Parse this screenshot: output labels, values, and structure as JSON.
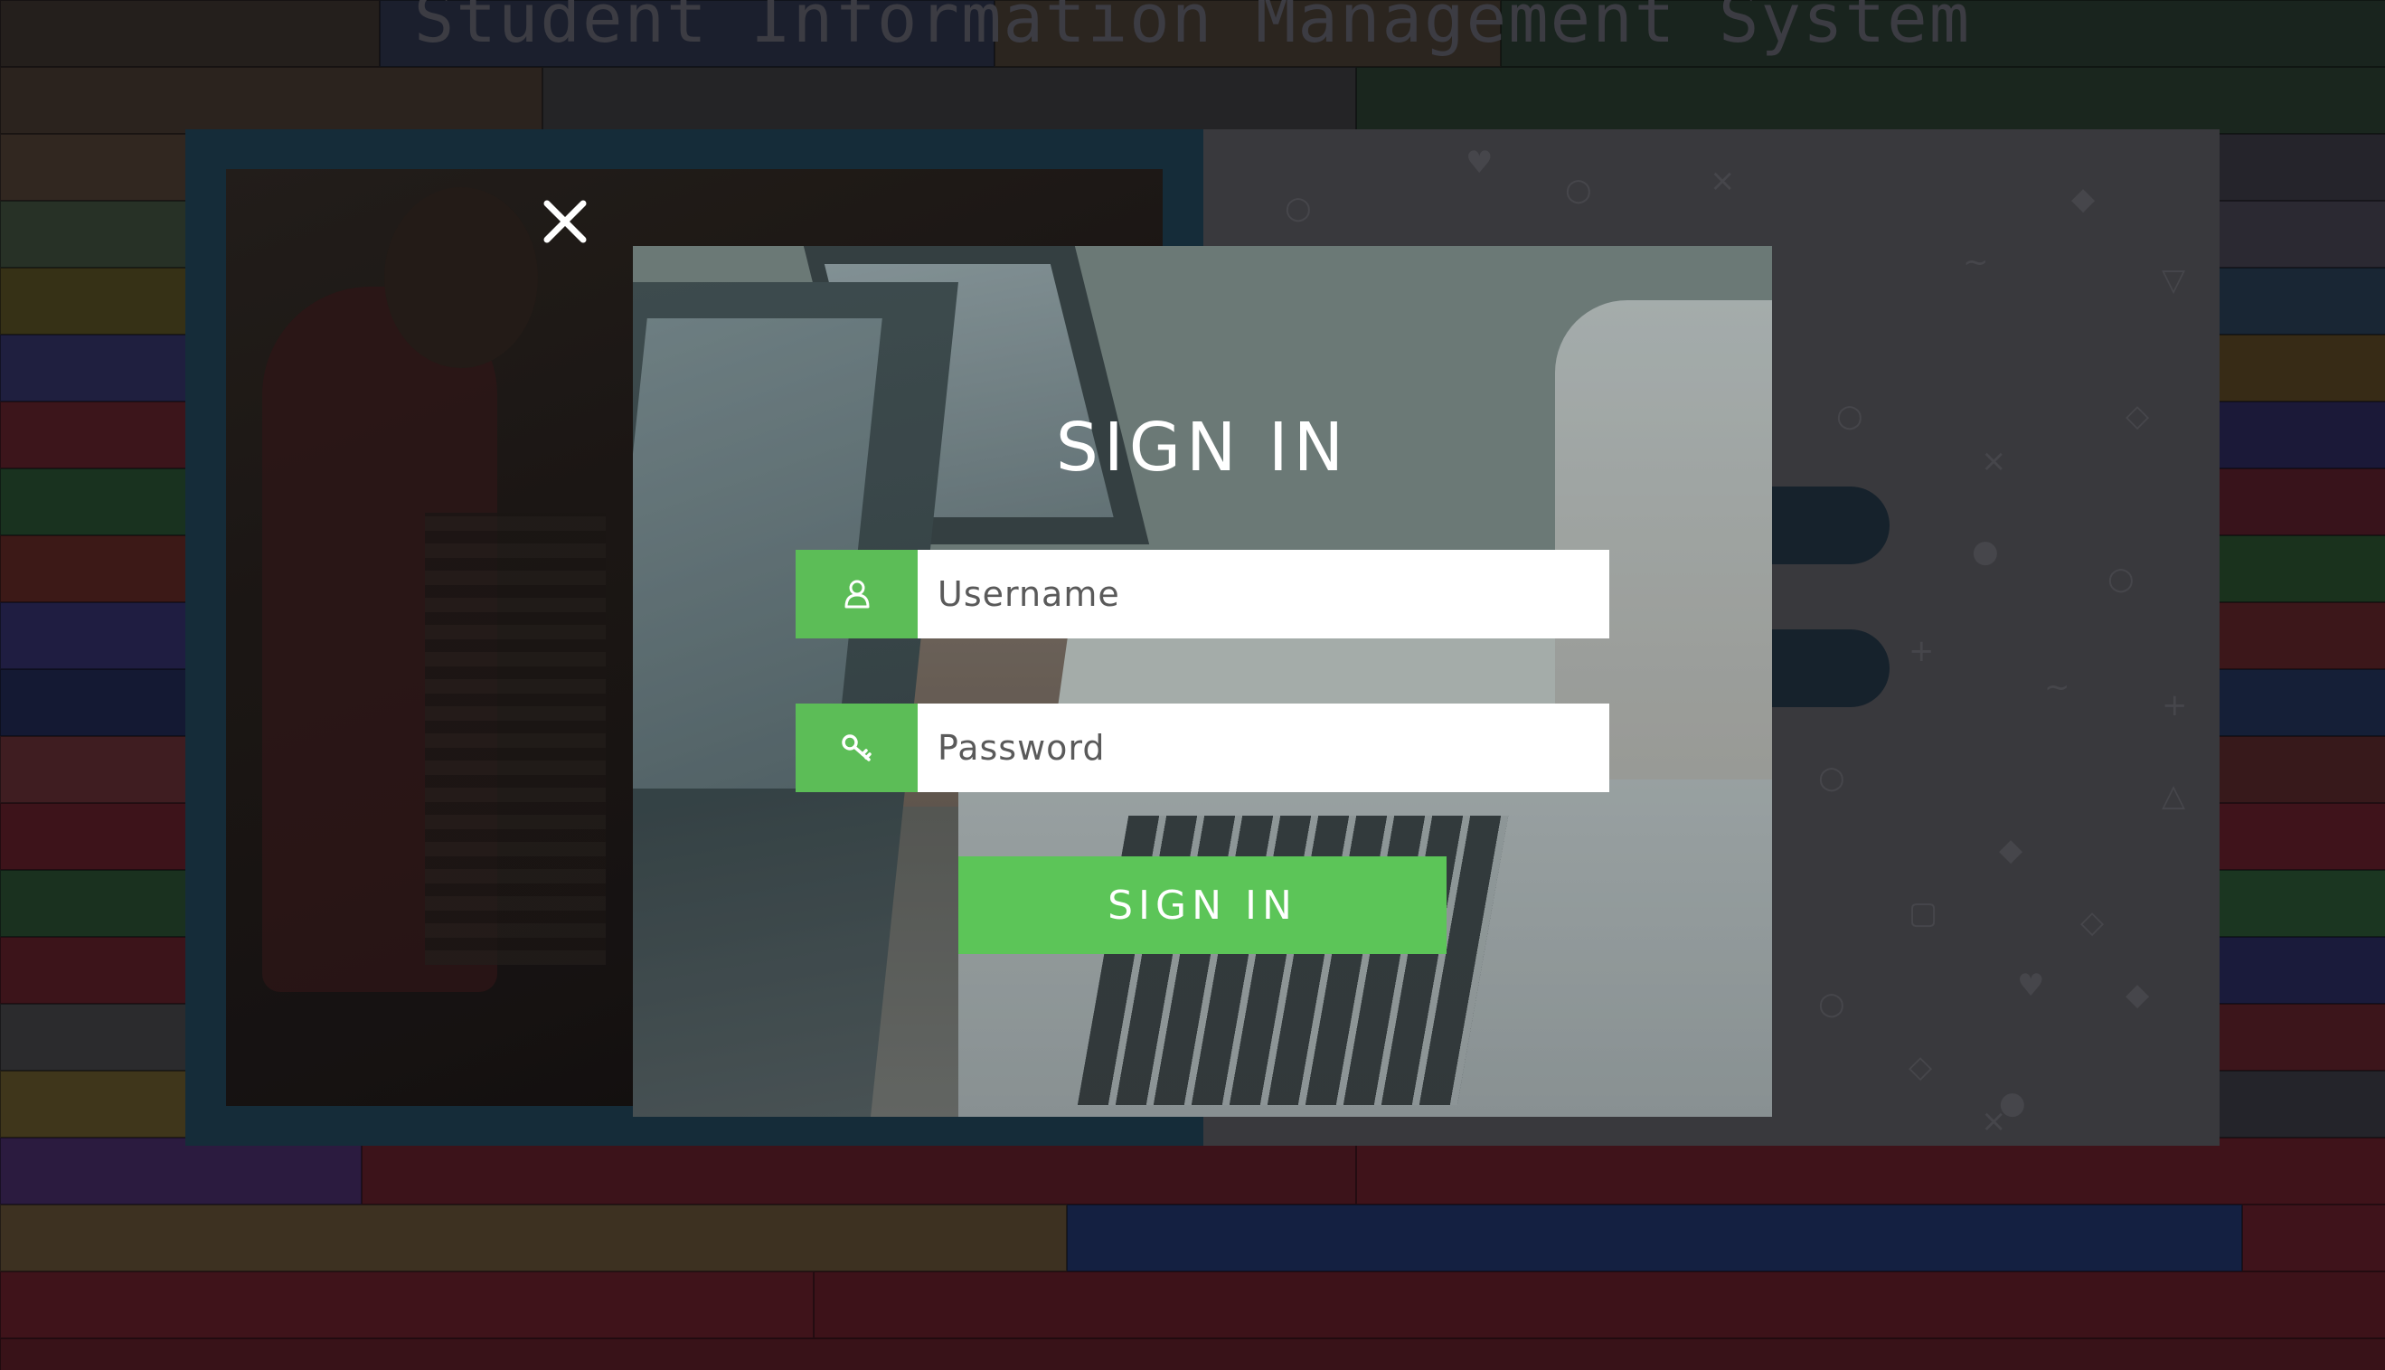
{
  "site": {
    "title": "Student Information Management System"
  },
  "modal": {
    "title": "SIGN IN",
    "username": {
      "placeholder": "Username",
      "value": "",
      "icon": "user-icon"
    },
    "password": {
      "placeholder": "Password",
      "value": "",
      "icon": "key-icon"
    },
    "submit_label": "SIGN IN",
    "close_icon": "close-icon"
  },
  "colors": {
    "accent_green": "#5cbd57",
    "card_frame": "#1a3646",
    "input_bg": "#ffffff",
    "text_light": "#ffffff"
  }
}
